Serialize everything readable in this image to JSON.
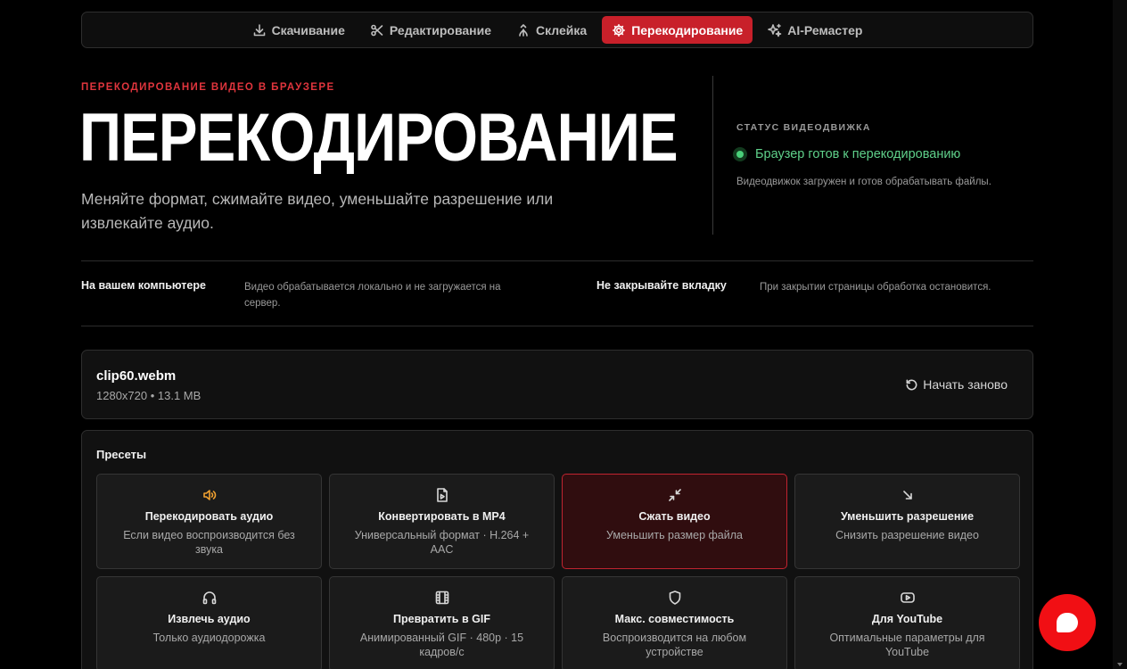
{
  "nav": {
    "tabs": [
      {
        "label": "Скачивание",
        "icon": "download-icon",
        "active": false
      },
      {
        "label": "Редактирование",
        "icon": "scissors-icon",
        "active": false
      },
      {
        "label": "Склейка",
        "icon": "merge-icon",
        "active": false
      },
      {
        "label": "Перекодирование",
        "icon": "gear-icon",
        "active": true
      },
      {
        "label": "AI-Ремастер",
        "icon": "sparkles-icon",
        "active": false
      }
    ]
  },
  "hero": {
    "eyebrow": "ПЕРЕКОДИРОВАНИЕ ВИДЕО В БРАУЗЕРЕ",
    "title": "ПЕРЕКОДИРОВАНИЕ",
    "description": "Меняйте формат, сжимайте видео, уменьшайте разрешение или извлекайте аудио."
  },
  "status": {
    "label": "СТАТУС ВИДЕОДВИЖКА",
    "text": "Браузер готов к перекодированию",
    "sub": "Видеодвижок загружен и готов обрабатывать файлы.",
    "color": "#4ad07a"
  },
  "info": [
    {
      "title": "На вашем компьютере",
      "text": "Видео обрабатывается локально и не загружается на сервер."
    },
    {
      "title": "Не закрывайте вкладку",
      "text": "При закрытии страницы обработка остановится."
    }
  ],
  "file": {
    "name": "clip60.webm",
    "meta": "1280x720 • 13.1 MB",
    "restart_label": "Начать заново"
  },
  "presets": {
    "title": "Пресеты",
    "items": [
      {
        "title": "Перекодировать аудио",
        "desc": "Если видео воспроизводится без звука",
        "icon": "speaker-icon",
        "selected": false
      },
      {
        "title": "Конвертировать в MP4",
        "desc": "Универсальный формат · H.264 + AAC",
        "icon": "video-file-icon",
        "selected": false
      },
      {
        "title": "Сжать видео",
        "desc": "Уменьшить размер файла",
        "icon": "compress-icon",
        "selected": true
      },
      {
        "title": "Уменьшить разрешение",
        "desc": "Снизить разрешение видео",
        "icon": "arrow-down-right-icon",
        "selected": false
      },
      {
        "title": "Извлечь аудио",
        "desc": "Только аудиодорожка",
        "icon": "headphones-icon",
        "selected": false
      },
      {
        "title": "Превратить в GIF",
        "desc": "Анимированный GIF · 480p · 15 кадров/с",
        "icon": "film-icon",
        "selected": false
      },
      {
        "title": "Макс. совместимость",
        "desc": "Воспроизводится на любом устройстве",
        "icon": "shield-icon",
        "selected": false
      },
      {
        "title": "Для YouTube",
        "desc": "Оптимальные параметры для YouTube",
        "icon": "youtube-icon",
        "selected": false
      }
    ]
  },
  "colors": {
    "accent": "#c8202a",
    "chat": "#f10f14"
  }
}
